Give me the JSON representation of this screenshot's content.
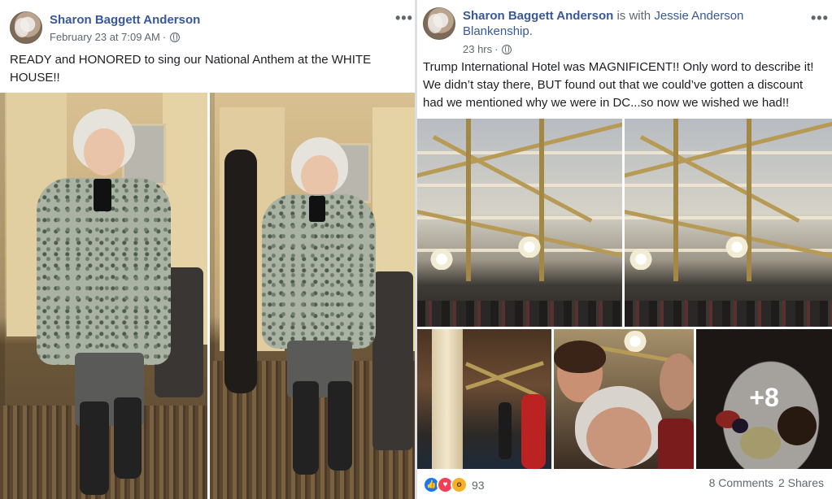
{
  "left_post": {
    "author": "Sharon Baggett Anderson",
    "timestamp": "February 23 at 7:09 AM",
    "separator": "·",
    "privacy_icon": "globe-icon",
    "more_icon": "•••",
    "text": "READY and HONORED to sing our National Anthem at the WHITE HOUSE!!",
    "photos": [
      "mirror-selfie-1",
      "mirror-selfie-2"
    ]
  },
  "right_post": {
    "author": "Sharon Baggett Anderson",
    "with_text": "is with",
    "tagged": "Jessie Anderson Blankenship.",
    "timestamp": "23 hrs",
    "separator": "·",
    "privacy_icon": "globe-icon",
    "more_icon": "•••",
    "text": "Trump International Hotel was MAGNIFICENT!! Only word to describe it! We didn’t stay there, BUT found out that we could’ve gotten a discount had we mentioned why we were in DC...so now we wished we had!!",
    "more_photos": "+8",
    "reactions": [
      "like",
      "love",
      "wow"
    ],
    "reaction_count": "93",
    "comments": "8 Comments",
    "shares": "2 Shares"
  },
  "colors": {
    "link": "#385898",
    "meta": "#606770",
    "like": "#1877f2",
    "love": "#f33e58",
    "wow": "#f7b125"
  }
}
